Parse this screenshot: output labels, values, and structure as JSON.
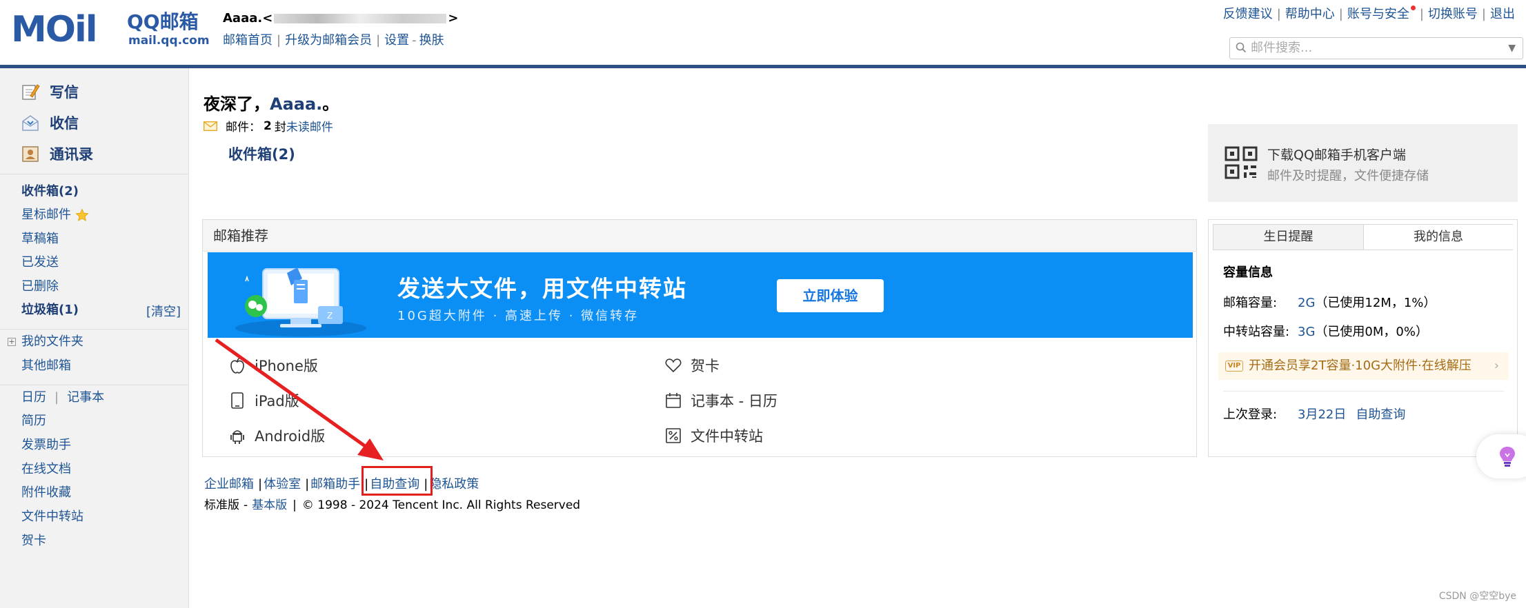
{
  "header": {
    "logo_text": "MOil",
    "logo_qq": "QQ邮箱",
    "logo_domain": "mail.qq.com",
    "user_name": "Aaaa.",
    "user_bracket_open": "<",
    "user_bracket_close": ">",
    "links": [
      "邮箱首页",
      "升级为邮箱会员",
      "设置",
      "换肤"
    ],
    "top_links": [
      "反馈建议",
      "帮助中心",
      "账号与安全",
      "切换账号",
      "退出"
    ],
    "search_placeholder": "邮件搜索..."
  },
  "sidebar": {
    "primary": [
      "写信",
      "收信",
      "通讯录"
    ],
    "folders": [
      "收件箱(2)",
      "星标邮件",
      "草稿箱",
      "已发送",
      "已删除",
      "垃圾箱(1)"
    ],
    "clear_label": "[清空]",
    "my_folders": "我的文件夹",
    "other_mail": "其他邮箱",
    "calendar": "日历",
    "notes": "记事本",
    "tools": [
      "简历",
      "发票助手",
      "在线文档",
      "附件收藏",
      "文件中转站",
      "贺卡"
    ]
  },
  "main": {
    "greeting_prefix": "夜深了，",
    "greeting_name": "Aaaa.",
    "greeting_suffix": "。",
    "mail_label": "邮件：",
    "mail_count": "2",
    "mail_unit": "封",
    "mail_unread": "未读邮件",
    "inbox_link": "收件箱(2)",
    "qr_title": "下载QQ邮箱手机客户端",
    "qr_sub": "邮件及时提醒，文件便捷存储",
    "recommend_title": "邮箱推荐",
    "banner_title": "发送大文件，用文件中转站",
    "banner_sub": "10G超大附件 · 高速上传 · 微信转存",
    "banner_button": "立即体验",
    "apps_left": [
      "iPhone版",
      "iPad版",
      "Android版"
    ],
    "apps_right": [
      "贺卡",
      "记事本 - 日历",
      "文件中转站"
    ]
  },
  "my_info": {
    "tabs": [
      "生日提醒",
      "我的信息"
    ],
    "capacity_title": "容量信息",
    "mail_capacity_label": "邮箱容量:",
    "mail_capacity_value": "2G",
    "mail_capacity_used": "（已使用12M，1%）",
    "transfer_capacity_label": "中转站容量:",
    "transfer_capacity_value": "3G",
    "transfer_capacity_used": "（已使用0M，0%）",
    "vip_text": "开通会员享2T容量·10G大附件·在线解压",
    "vip_badge": "VIP",
    "last_login_label": "上次登录:",
    "last_login_date": "3月22日",
    "last_login_link": "自助查询"
  },
  "footer": {
    "links": [
      "企业邮箱",
      "体验室",
      "邮箱助手",
      "自助查询",
      "隐私政策"
    ],
    "version_label": "标准版",
    "basic_link": "基本版",
    "copyright": "© 1998 - 2024 Tencent Inc. All Rights Reserved"
  },
  "watermark": "CSDN @空空bye",
  "colors": {
    "accent": "#1e5494",
    "banner": "#0b8ff5",
    "highlight": "#e02020"
  }
}
